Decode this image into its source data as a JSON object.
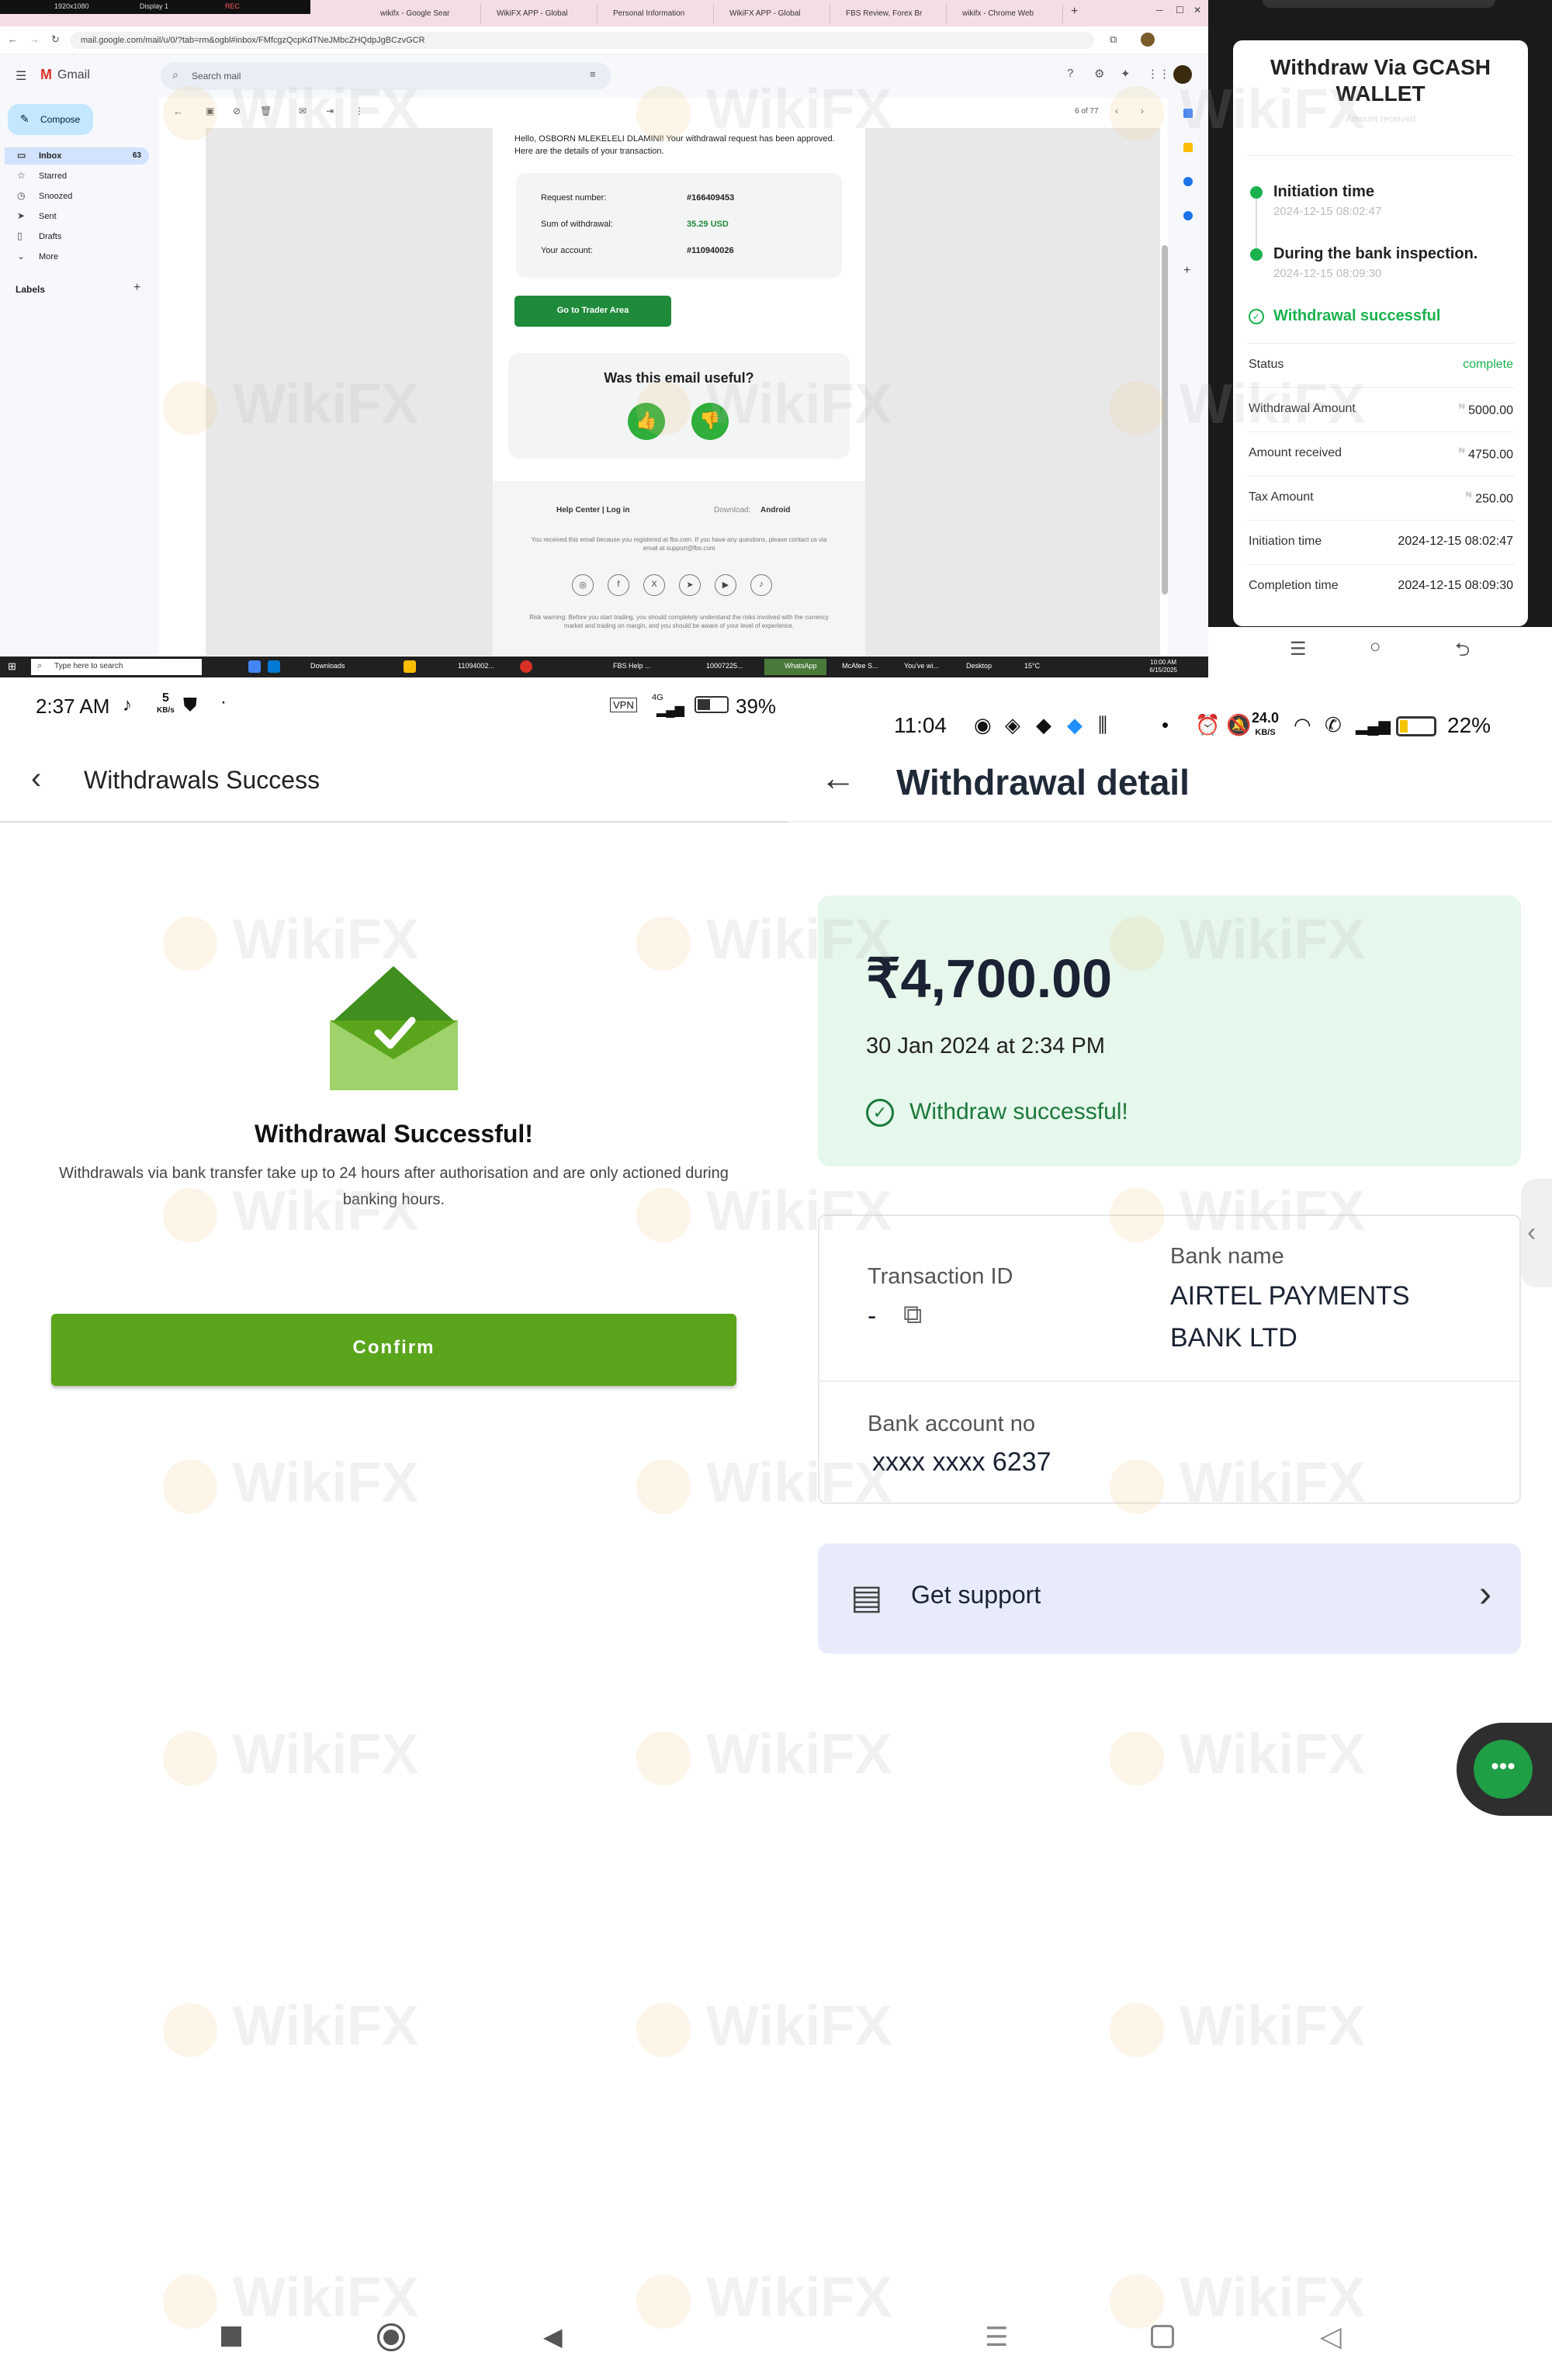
{
  "desktop": {
    "topbar": {
      "display_res": "1920x1080",
      "display": "Display 1",
      "rec": "REC"
    },
    "tabs": [
      "wikifx - Google Sear",
      "WikiFX APP - Global",
      "Personal Information",
      "WikiFX APP - Global",
      "FBS Review, Forex Br",
      "wikifx - Chrome Web"
    ],
    "url": "mail.google.com/mail/u/0/?tab=rm&ogbl#inbox/FMfcgzQcpKdTNeJMbcZHQdpJgBCzvGCR",
    "gmail": {
      "app_name": "Gmail",
      "search_placeholder": "Search mail",
      "compose": "Compose",
      "nav": [
        {
          "label": "Inbox",
          "count": "63",
          "icon": "inbox-icon"
        },
        {
          "label": "Starred",
          "count": "",
          "icon": "star-icon"
        },
        {
          "label": "Snoozed",
          "count": "",
          "icon": "clock-icon"
        },
        {
          "label": "Sent",
          "count": "",
          "icon": "send-icon"
        },
        {
          "label": "Drafts",
          "count": "",
          "icon": "draft-icon"
        },
        {
          "label": "More",
          "count": "",
          "icon": "chevron-down-icon"
        }
      ],
      "labels_heading": "Labels",
      "pager": "6 of 77"
    },
    "email": {
      "greeting": "Hello, OSBORN MLEKELELI DLAMINI! Your withdrawal request has been approved. Here are the details of your transaction.",
      "details": [
        {
          "key": "Request number:",
          "value": "#166409453"
        },
        {
          "key": "Sum of withdrawal:",
          "value": "35.29 USD"
        },
        {
          "key": "Your account:",
          "value": "#110940026"
        }
      ],
      "button": "Go to Trader Area",
      "useful_title": "Was this email useful?",
      "footer_links": "Help Center  |  Log in",
      "download": "Download:",
      "android": "Android",
      "footer_note": "You received this email because you registered at fbs.com. If you have any questions, please contact us via email at support@fbs.com",
      "risk_warning": "Risk warning: Before you start trading, you should completely understand the risks involved with the currency market and trading on margin, and you should be aware of your level of experience."
    },
    "taskbar": {
      "search_placeholder": "Type here to search",
      "items": [
        "Downloads",
        "11094002...",
        "FBS Help ...",
        "10007225...",
        "WhatsApp",
        "McAfee S...",
        "You've wi...",
        "Desktop"
      ],
      "temp": "15°C",
      "time": "10:00 AM",
      "date": "6/15/2025"
    }
  },
  "gcash": {
    "title": "Withdraw Via GCASH WALLET",
    "subtitle": "Amount received",
    "steps": [
      {
        "label": "Initiation time",
        "date": "2024-12-15 08:02:47"
      },
      {
        "label": "During the bank inspection.",
        "date": "2024-12-15 08:09:30"
      },
      {
        "label": "Withdrawal successful",
        "date": ""
      }
    ],
    "rows": [
      {
        "key": "Status",
        "value": "complete"
      },
      {
        "key": "Withdrawal Amount",
        "value": "5000.00",
        "currency": "₦"
      },
      {
        "key": "Amount received",
        "value": "4750.00",
        "currency": "₦"
      },
      {
        "key": "Tax Amount",
        "value": "250.00",
        "currency": "₦"
      },
      {
        "key": "Initiation time",
        "value": "2024-12-15 08:02:47"
      },
      {
        "key": "Completion time",
        "value": "2024-12-15 08:09:30"
      }
    ],
    "accent": "#19b24d"
  },
  "withdrawals_success": {
    "status_time": "2:37 AM",
    "status_speed": "5",
    "status_speed_unit": "KB/s",
    "status_vpn": "VPN",
    "status_net": "4G",
    "battery": "39%",
    "header_title": "Withdrawals Success",
    "heading": "Withdrawal Successful!",
    "description": "Withdrawals via bank transfer take up to 24 hours after authorisation and are only actioned during banking hours.",
    "confirm": "Confirm",
    "accent": "#5aa51c"
  },
  "withdrawal_detail": {
    "status_time": "11:04",
    "status_speed": "24.0",
    "status_speed_unit": "KB/S",
    "battery": "22%",
    "header_title": "Withdrawal detail",
    "amount": "₹4,700.00",
    "date": "30 Jan 2024 at 2:34 PM",
    "success": "Withdraw successful!",
    "transaction_id_label": "Transaction ID",
    "transaction_id_value": "-",
    "bank_name_label": "Bank name",
    "bank_name_value": "AIRTEL PAYMENTS BANK LTD",
    "bank_account_label": "Bank account no",
    "bank_account_value": "xxxx xxxx 6237",
    "support": "Get support",
    "accent": "#1b7a3a"
  },
  "watermark": "WikiFX"
}
